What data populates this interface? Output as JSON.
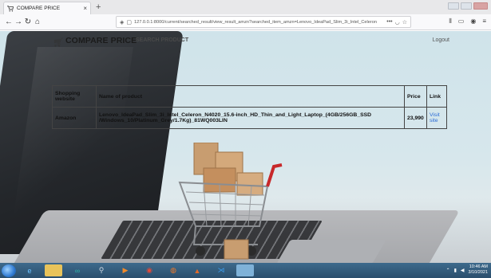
{
  "browser": {
    "tab_title": "COMPARE PRICE",
    "tab_close": "×",
    "new_tab": "+",
    "url": "127.0.0.1:8000/current/searched_result/view_result_amzn?searched_item_amzn=Lenovo_IdeaPad_Slim_3i_Intel_Celeron",
    "url_more": "•••"
  },
  "site": {
    "title": "COMPARE PRICE",
    "search_label": "SEARCH PRODUCT",
    "logout_label": "Logout"
  },
  "table": {
    "headers": [
      "Shopping website",
      "Name of product",
      "Price",
      "Link"
    ],
    "rows": [
      {
        "website": "Amazon",
        "product": "Lenovo_IdeaPad_Slim_3i_Intel_Celeron_N4020_15.6-inch_HD_Thin_and_Light_Laptop_(4GB/256GB_SSD /Windows_10/Platinum_Grey/1.7Kg)_81WQ003LIN",
        "price": "23,990",
        "link_label": "Visit site"
      }
    ]
  },
  "taskbar": {
    "clock_time": "10:46 AM",
    "clock_date": "3/10/2021"
  }
}
